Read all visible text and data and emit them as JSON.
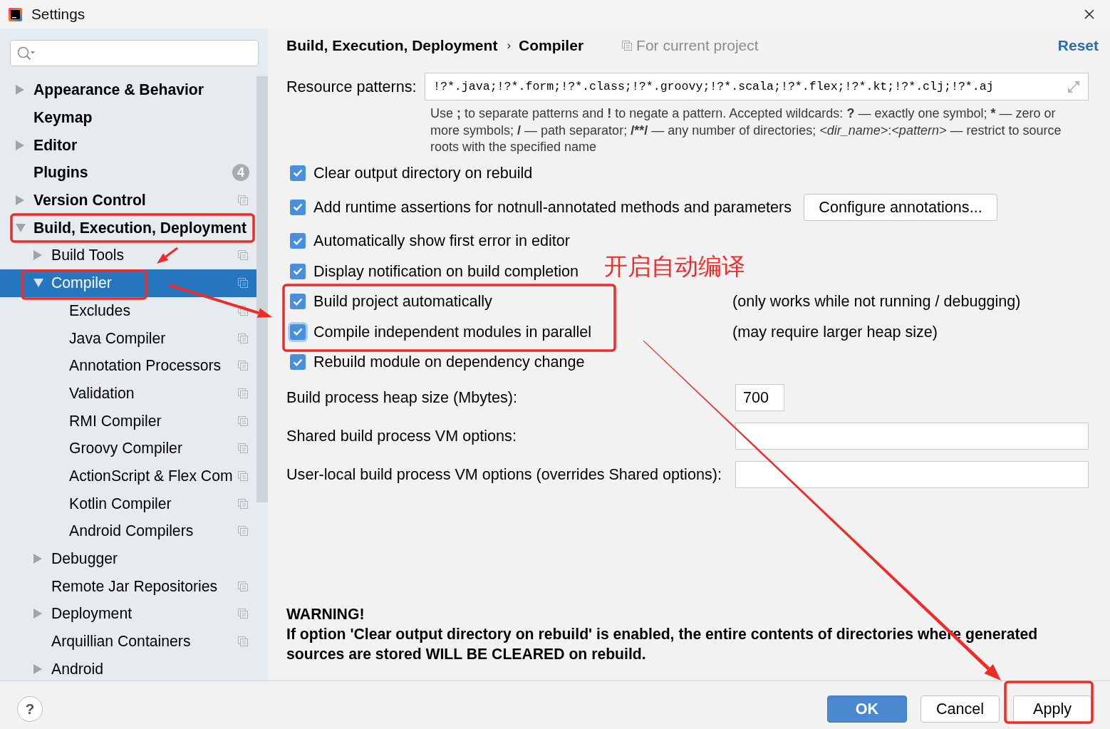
{
  "window": {
    "title": "Settings"
  },
  "sidebar": {
    "items": [
      {
        "label": "Appearance & Behavior",
        "kind": "group",
        "expanded": false,
        "selected": false,
        "per_project": false
      },
      {
        "label": "Keymap",
        "kind": "page",
        "expanded": false,
        "selected": false,
        "per_project": false
      },
      {
        "label": "Editor",
        "kind": "group",
        "expanded": false,
        "selected": false,
        "per_project": false
      },
      {
        "label": "Plugins",
        "kind": "page",
        "expanded": false,
        "selected": false,
        "per_project": false,
        "badge": "4"
      },
      {
        "label": "Version Control",
        "kind": "group",
        "expanded": false,
        "selected": false,
        "per_project": true
      },
      {
        "label": "Build, Execution, Deployment",
        "kind": "group",
        "expanded": true,
        "selected": false,
        "per_project": false,
        "children": [
          {
            "label": "Build Tools",
            "kind": "group",
            "expanded": false,
            "selected": false,
            "per_project": true
          },
          {
            "label": "Compiler",
            "kind": "group",
            "expanded": true,
            "selected": true,
            "per_project": true,
            "children": [
              {
                "label": "Excludes",
                "kind": "page",
                "expanded": false,
                "selected": false,
                "per_project": true
              },
              {
                "label": "Java Compiler",
                "kind": "page",
                "expanded": false,
                "selected": false,
                "per_project": true
              },
              {
                "label": "Annotation Processors",
                "kind": "page",
                "expanded": false,
                "selected": false,
                "per_project": true
              },
              {
                "label": "Validation",
                "kind": "page",
                "expanded": false,
                "selected": false,
                "per_project": true
              },
              {
                "label": "RMI Compiler",
                "kind": "page",
                "expanded": false,
                "selected": false,
                "per_project": true
              },
              {
                "label": "Groovy Compiler",
                "kind": "page",
                "expanded": false,
                "selected": false,
                "per_project": true
              },
              {
                "label": "ActionScript & Flex Com",
                "kind": "page",
                "expanded": false,
                "selected": false,
                "per_project": true
              },
              {
                "label": "Kotlin Compiler",
                "kind": "page",
                "expanded": false,
                "selected": false,
                "per_project": true
              },
              {
                "label": "Android Compilers",
                "kind": "page",
                "expanded": false,
                "selected": false,
                "per_project": true
              }
            ]
          },
          {
            "label": "Debugger",
            "kind": "group",
            "expanded": false,
            "selected": false,
            "per_project": false
          },
          {
            "label": "Remote Jar Repositories",
            "kind": "page",
            "expanded": false,
            "selected": false,
            "per_project": true
          },
          {
            "label": "Deployment",
            "kind": "group",
            "expanded": false,
            "selected": false,
            "per_project": true
          },
          {
            "label": "Arquillian Containers",
            "kind": "page",
            "expanded": false,
            "selected": false,
            "per_project": true
          },
          {
            "label": "Android",
            "kind": "group",
            "expanded": false,
            "selected": false,
            "per_project": false
          }
        ]
      }
    ]
  },
  "page": {
    "breadcrumb": {
      "parent": "Build, Execution, Deployment",
      "separator": "›",
      "current": "Compiler"
    },
    "scope": "For current project",
    "reset": "Reset",
    "resource_patterns": {
      "label": "Resource patterns:",
      "value": "!?*.java;!?*.form;!?*.class;!?*.groovy;!?*.scala;!?*.flex;!?*.kt;!?*.clj;!?*.aj"
    },
    "help": [
      {
        "text": "Use ",
        "kind": "plain"
      },
      {
        "text": ";",
        "kind": "bold"
      },
      {
        "text": " to separate patterns and ",
        "kind": "plain"
      },
      {
        "text": "!",
        "kind": "bold"
      },
      {
        "text": " to negate a pattern. Accepted wildcards: ",
        "kind": "plain"
      },
      {
        "text": "?",
        "kind": "bold"
      },
      {
        "text": " — exactly one symbol; ",
        "kind": "plain"
      },
      {
        "text": "*",
        "kind": "bold"
      },
      {
        "text": " — zero or more symbols; ",
        "kind": "plain"
      },
      {
        "text": "/",
        "kind": "bold"
      },
      {
        "text": " — path separator; ",
        "kind": "plain"
      },
      {
        "text": "/**/",
        "kind": "bold"
      },
      {
        "text": " — any number of directories; ",
        "kind": "plain"
      },
      {
        "text": "<dir_name>",
        "kind": "italic"
      },
      {
        "text": ":",
        "kind": "plain"
      },
      {
        "text": "<pattern>",
        "kind": "italic"
      },
      {
        "text": " — restrict to source roots with the specified name",
        "kind": "plain"
      }
    ],
    "options": [
      {
        "label": "Clear output directory on rebuild",
        "checked": true,
        "focused": false
      },
      {
        "label": "Add runtime assertions for notnull-annotated methods and parameters",
        "checked": true,
        "focused": false,
        "button": "Configure annotations..."
      },
      {
        "label": "Automatically show first error in editor",
        "checked": true,
        "focused": false
      },
      {
        "label": "Display notification on build completion",
        "checked": true,
        "focused": false
      },
      {
        "label": "Build project automatically",
        "checked": true,
        "focused": false,
        "note": "(only works while not running / debugging)"
      },
      {
        "label": "Compile independent modules in parallel",
        "checked": true,
        "focused": true,
        "note": "(may require larger heap size)"
      },
      {
        "label": "Rebuild module on dependency change",
        "checked": true,
        "focused": false
      }
    ],
    "fields": [
      {
        "label": "Build process heap size (Mbytes):",
        "kind": "number",
        "value": "700"
      },
      {
        "label": "Shared build process VM options:",
        "kind": "text"
      },
      {
        "label": "User-local build process VM options (overrides Shared options):",
        "kind": "text"
      }
    ],
    "warning": {
      "title": "WARNING!",
      "text": "If option 'Clear output directory on rebuild' is enabled, the entire contents of directories where generated sources are stored WILL BE CLEARED on rebuild."
    }
  },
  "footer": {
    "help": "?",
    "buttons": [
      {
        "label": "OK",
        "kind": "primary"
      },
      {
        "label": "Cancel",
        "kind": "default"
      },
      {
        "label": "Apply",
        "kind": "default"
      }
    ]
  },
  "annotation": {
    "note": "开启自动编译"
  }
}
